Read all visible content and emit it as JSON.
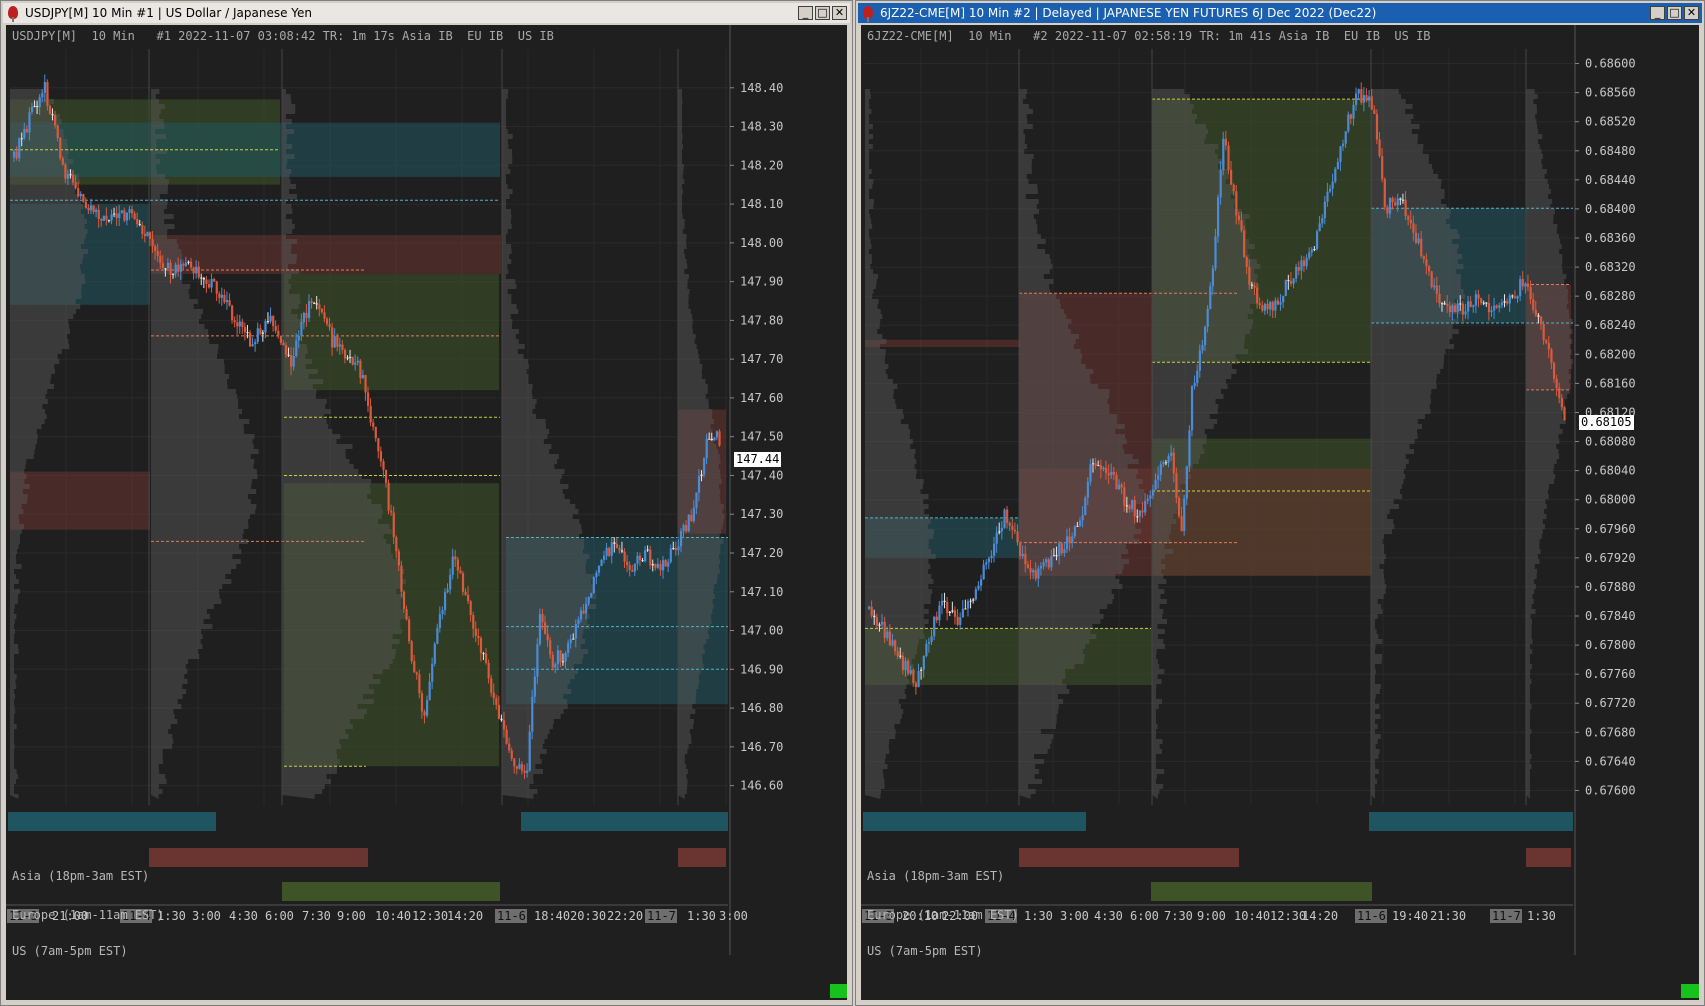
{
  "windows": [
    {
      "title": "USDJPY[M]  10 Min  #1 | US Dollar / Japanese Yen",
      "info": "USDJPY[M]  10 Min   #1 2022-11-07 03:08:42 TR: 1m 17s Asia IB  EU IB  US IB",
      "last_price": "147.44",
      "sessions": [
        "Asia (18pm-3am EST)",
        "Europe (1am-11am EST)",
        "US (7am-5pm EST)"
      ],
      "x_labels": [
        "11-3",
        "21:00",
        "11-4",
        "1:30",
        "3:00",
        "4:30",
        "6:00",
        "7:30",
        "9:00",
        "10:40",
        "12:30",
        "14:20",
        "11-6",
        "18:40",
        "20:30",
        "22:20",
        "11-7",
        "1:30",
        "3:00"
      ],
      "chart_data": {
        "type": "candlestick",
        "interval": "10 Min",
        "y_ticks": [
          "148.40",
          "148.30",
          "148.20",
          "148.10",
          "148.00",
          "147.90",
          "147.80",
          "147.70",
          "147.60",
          "147.50",
          "147.40",
          "147.30",
          "147.20",
          "147.10",
          "147.00",
          "146.90",
          "146.80",
          "146.70",
          "146.60"
        ],
        "ylim": [
          146.55,
          148.5
        ],
        "close_path": [
          [
            0,
            148.22
          ],
          [
            6,
            148.32
          ],
          [
            12,
            148.4
          ],
          [
            20,
            148.18
          ],
          [
            28,
            148.1
          ],
          [
            36,
            148.05
          ],
          [
            44,
            148.08
          ],
          [
            52,
            148.02
          ],
          [
            60,
            147.93
          ],
          [
            68,
            147.95
          ],
          [
            76,
            147.9
          ],
          [
            84,
            147.83
          ],
          [
            92,
            147.74
          ],
          [
            100,
            147.8
          ],
          [
            108,
            147.7
          ],
          [
            116,
            147.86
          ],
          [
            124,
            147.75
          ],
          [
            132,
            147.7
          ],
          [
            136,
            147.66
          ],
          [
            140,
            147.52
          ],
          [
            144,
            147.4
          ],
          [
            148,
            147.25
          ],
          [
            152,
            147.05
          ],
          [
            156,
            146.9
          ],
          [
            160,
            146.78
          ],
          [
            164,
            146.95
          ],
          [
            168,
            147.1
          ],
          [
            172,
            147.2
          ],
          [
            176,
            147.08
          ],
          [
            180,
            147.0
          ],
          [
            184,
            146.9
          ],
          [
            188,
            146.8
          ],
          [
            192,
            146.72
          ],
          [
            196,
            146.65
          ],
          [
            200,
            146.65
          ],
          [
            205,
            147.05
          ],
          [
            210,
            146.92
          ],
          [
            216,
            146.95
          ],
          [
            222,
            147.05
          ],
          [
            228,
            147.18
          ],
          [
            234,
            147.22
          ],
          [
            240,
            147.15
          ],
          [
            246,
            147.2
          ],
          [
            252,
            147.16
          ],
          [
            258,
            147.21
          ],
          [
            264,
            147.3
          ],
          [
            270,
            147.48
          ],
          [
            274,
            147.52
          ],
          [
            276,
            147.44
          ]
        ],
        "value_area_levels": [
          148.24,
          148.11,
          147.93,
          147.76,
          147.55,
          147.4,
          147.23,
          146.65,
          147.24,
          147.01,
          146.9
        ]
      },
      "colors": {
        "up": "#4c8cd6",
        "down": "#d95a3c",
        "doji": "#e8e8e8",
        "asia": "#1f5560",
        "europe": "#6a3431",
        "us": "#3e5426"
      }
    },
    {
      "title": "6JZ22-CME[M]  10 Min  #2 |  Delayed |  JAPANESE YEN FUTURES 6J Dec 2022 (Dec22)",
      "info": "6JZ22-CME[M]  10 Min   #2 2022-11-07 02:58:19 TR: 1m 41s Asia IB  EU IB  US IB",
      "last_price": "0.68105",
      "sessions": [
        "Asia (18pm-3am EST)",
        "Europe (1am-11am EST)",
        "US (7am-5pm EST)"
      ],
      "x_labels": [
        "11-3",
        "20:10",
        "22:00",
        "11-4",
        "1:30",
        "3:00",
        "4:30",
        "6:00",
        "7:30",
        "9:00",
        "10:40",
        "12:30",
        "14:20",
        "11-6",
        "19:40",
        "21:30",
        "11-7",
        "1:30"
      ],
      "chart_data": {
        "type": "candlestick",
        "interval": "10 Min",
        "y_ticks": [
          "0.68600",
          "0.68560",
          "0.68520",
          "0.68480",
          "0.68440",
          "0.68400",
          "0.68360",
          "0.68320",
          "0.68280",
          "0.68240",
          "0.68200",
          "0.68160",
          "0.68120",
          "0.68080",
          "0.68040",
          "0.68000",
          "0.67960",
          "0.67920",
          "0.67880",
          "0.67840",
          "0.67800",
          "0.67760",
          "0.67720",
          "0.67680",
          "0.67640",
          "0.67600"
        ],
        "ylim": [
          0.6758,
          0.6862
        ],
        "close_path": [
          [
            0,
            0.6785
          ],
          [
            6,
            0.6782
          ],
          [
            12,
            0.6778
          ],
          [
            18,
            0.6775
          ],
          [
            22,
            0.678
          ],
          [
            28,
            0.6786
          ],
          [
            34,
            0.6783
          ],
          [
            40,
            0.6787
          ],
          [
            46,
            0.6792
          ],
          [
            52,
            0.6798
          ],
          [
            58,
            0.6793
          ],
          [
            64,
            0.679
          ],
          [
            70,
            0.6792
          ],
          [
            76,
            0.6794
          ],
          [
            82,
            0.6798
          ],
          [
            86,
            0.6806
          ],
          [
            92,
            0.6804
          ],
          [
            98,
            0.68
          ],
          [
            104,
            0.6798
          ],
          [
            110,
            0.6803
          ],
          [
            116,
            0.6806
          ],
          [
            120,
            0.6796
          ],
          [
            124,
            0.6815
          ],
          [
            128,
            0.6822
          ],
          [
            132,
            0.6832
          ],
          [
            136,
            0.685
          ],
          [
            140,
            0.6842
          ],
          [
            146,
            0.683
          ],
          [
            152,
            0.6826
          ],
          [
            158,
            0.6828
          ],
          [
            164,
            0.6832
          ],
          [
            170,
            0.6834
          ],
          [
            176,
            0.6842
          ],
          [
            182,
            0.685
          ],
          [
            188,
            0.6856
          ],
          [
            194,
            0.6854
          ],
          [
            198,
            0.684
          ],
          [
            204,
            0.6842
          ],
          [
            210,
            0.6836
          ],
          [
            216,
            0.683
          ],
          [
            222,
            0.6826
          ],
          [
            228,
            0.6826
          ],
          [
            234,
            0.6828
          ],
          [
            240,
            0.6826
          ],
          [
            246,
            0.6828
          ],
          [
            252,
            0.683
          ],
          [
            258,
            0.6824
          ],
          [
            264,
            0.6816
          ],
          [
            268,
            0.68105
          ]
        ],
        "value_area_levels": [
          0.68551,
          0.68284,
          0.68189,
          0.67941,
          0.67823,
          0.68012,
          0.67975,
          0.68401,
          0.68243,
          0.68296,
          0.68151
        ]
      },
      "colors": {
        "up": "#4c8cd6",
        "down": "#d95a3c",
        "doji": "#e8e8e8",
        "asia": "#1f5560",
        "europe": "#6a3431",
        "us": "#3e5426"
      }
    }
  ],
  "window_buttons": {
    "minimize": "_",
    "maximize": "□",
    "close": "✕"
  }
}
